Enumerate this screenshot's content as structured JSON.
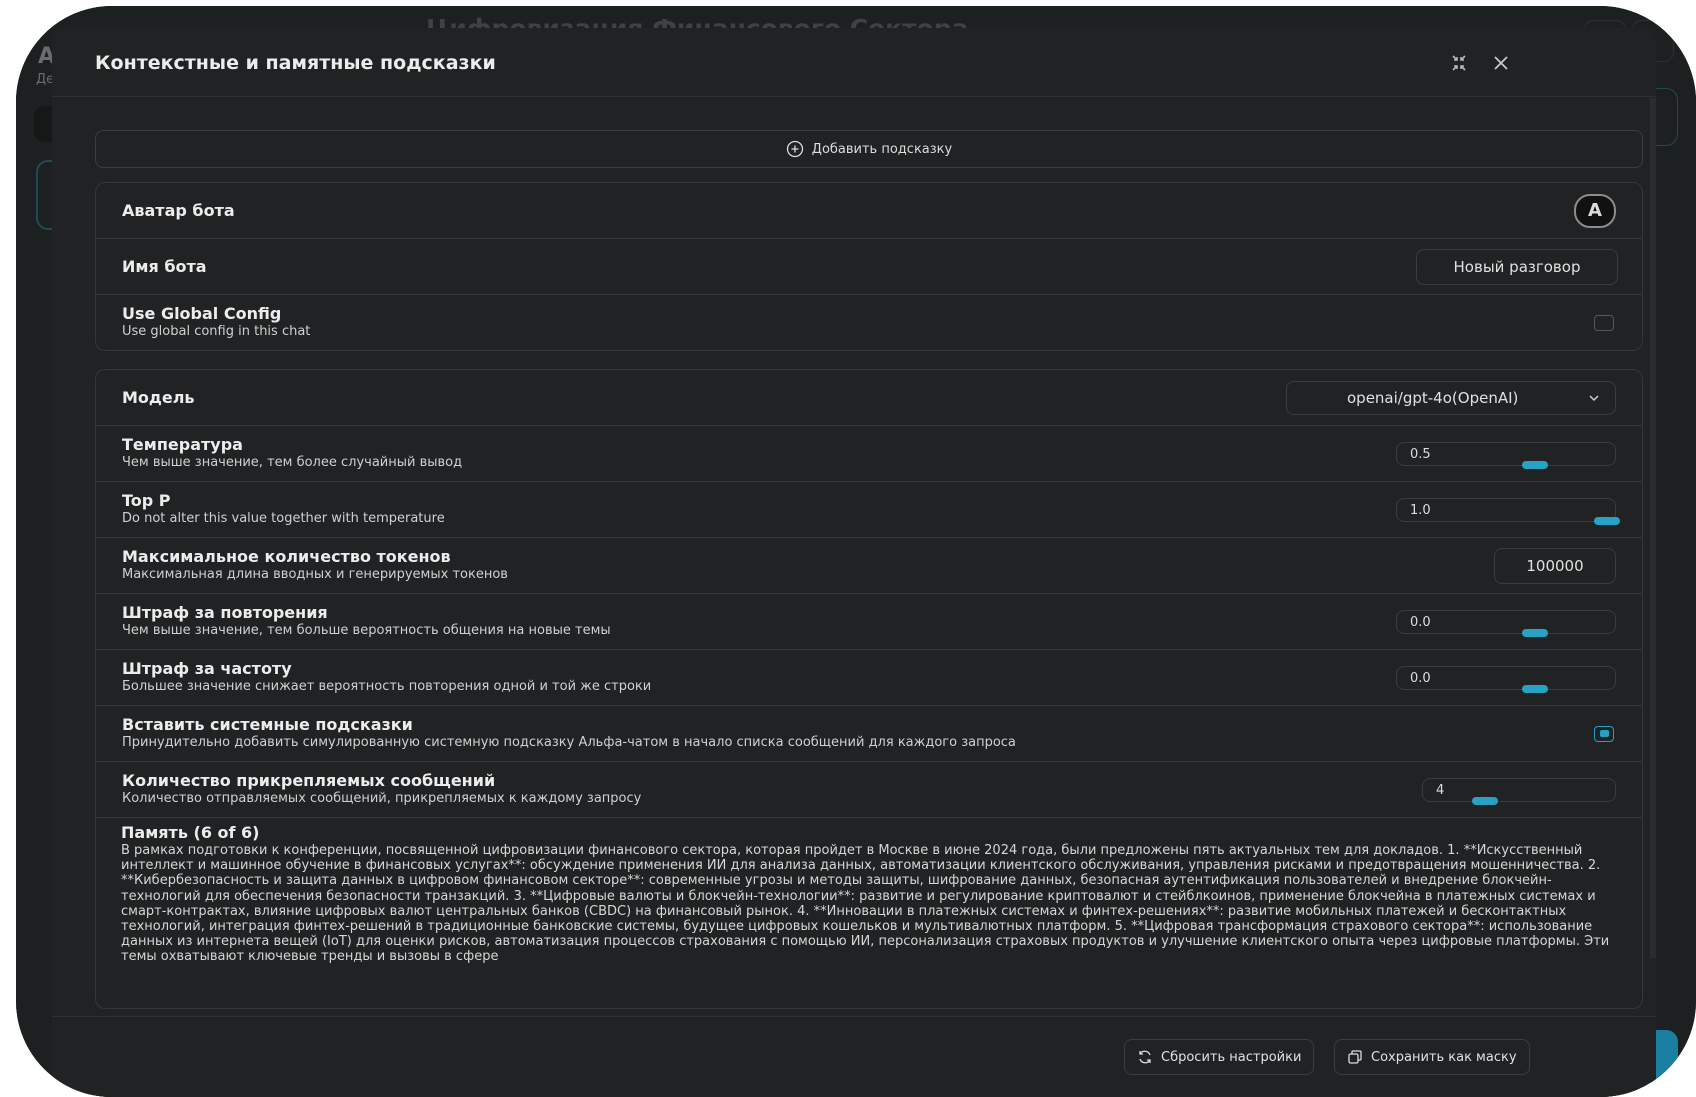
{
  "background": {
    "title": "Цифровизация Финансового Сектора",
    "left_letter": "А",
    "left_sub": "Де"
  },
  "modal": {
    "title": "Контекстные и памятные подсказки",
    "add_prompt_label": "Добавить подсказку"
  },
  "bot": {
    "avatar_label": "Аватар бота",
    "avatar_glyph": "A",
    "name_label": "Имя бота",
    "name_value": "Новый разговор",
    "global_title": "Use Global Config",
    "global_sub": "Use global config in this chat",
    "global_checked": false
  },
  "settings": {
    "model_label": "Модель",
    "model_value": "openai/gpt-4o(OpenAI)",
    "temperature": {
      "title": "Температура",
      "sub": "Чем выше значение, тем более случайный вывод",
      "value": "0.5",
      "fraction": 0.5
    },
    "top_p": {
      "title": "Top P",
      "sub": "Do not alter this value together with temperature",
      "value": "1.0",
      "fraction": 1.0
    },
    "max_tokens": {
      "title": "Максимальное количество токенов",
      "sub": "Максимальная длина вводных и генерируемых токенов",
      "value": "100000"
    },
    "presence_penalty": {
      "title": "Штраф за повторения",
      "sub": "Чем выше значение, тем больше вероятность общения на новые темы",
      "value": "0.0",
      "fraction": 0.5
    },
    "frequency_penalty": {
      "title": "Штраф за частоту",
      "sub": "Большее значение снижает вероятность повторения одной и той же строки",
      "value": "0.0",
      "fraction": 0.5
    },
    "inject_system": {
      "title": "Вставить системные подсказки",
      "sub": "Принудительно добавить симулированную системную подсказку Альфа-чатом в начало списка сообщений для каждого запроса",
      "checked": true
    },
    "history_count": {
      "title": "Количество прикрепляемых сообщений",
      "sub": "Количество отправляемых сообщений, прикрепляемых к каждому запросу",
      "value": "4",
      "fraction": 0.125
    }
  },
  "memory": {
    "title": "Память (6 of 6)",
    "text": "В рамках подготовки к конференции, посвященной цифровизации финансового сектора, которая пройдет в Москве в июне 2024 года, были предложены пять актуальных тем для докладов. 1. **Искусственный интеллект и машинное обучение в финансовых услугах**: обсуждение применения ИИ для анализа данных, автоматизации клиентского обслуживания, управления рисками и предотвращения мошенничества. 2. **Кибербезопасность и защита данных в цифровом финансовом секторе**: современные угрозы и методы защиты, шифрование данных, безопасная аутентификация пользователей и внедрение блокчейн-технологий для обеспечения безопасности транзакций. 3. **Цифровые валюты и блокчейн-технологии**: развитие и регулирование криптовалют и стейблкоинов, применение блокчейна в платежных системах и смарт-контрактах, влияние цифровых валют центральных банков (CBDC) на финансовый рынок. 4. **Инновации в платежных системах и финтех-решениях**: развитие мобильных платежей и бесконтактных технологий, интеграция финтех-решений в традиционные банковские системы, будущее цифровых кошельков и мультивалютных платформ. 5. **Цифровая трансформация страхового сектора**: использование данных из интернета вещей (IoT) для оценки рисков, автоматизация процессов страхования с помощью ИИ, персонализация страховых продуктов и улучшение клиентского опыта через цифровые платформы. Эти темы охватывают ключевые тренды и вызовы в сфере"
  },
  "footer": {
    "reset_label": "Сбросить настройки",
    "save_mask_label": "Сохранить как маску"
  },
  "colors": {
    "accent": "#27a2c4",
    "modal_bg": "#202223"
  },
  "icons": [
    "minimize-icon",
    "close-icon",
    "add-circle-icon",
    "chevron-down-icon",
    "reset-icon",
    "copy-icon"
  ]
}
